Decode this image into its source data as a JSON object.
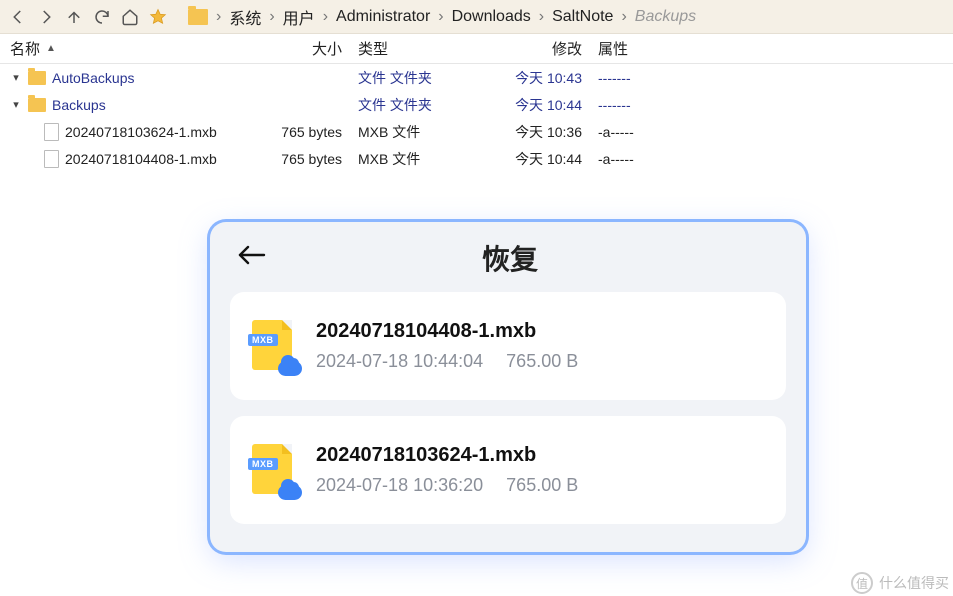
{
  "breadcrumb": [
    "系统",
    "用户",
    "Administrator",
    "Downloads",
    "SaltNote",
    "Backups"
  ],
  "columns": {
    "name": "名称",
    "size": "大小",
    "type": "类型",
    "modified": "修改",
    "attr": "属性"
  },
  "rows": [
    {
      "kind": "folder",
      "name": "AutoBackups",
      "size": "",
      "type": "文件 文件夹",
      "modified": "今天 10:43",
      "attr": "-------",
      "expanded": true,
      "indent": 0
    },
    {
      "kind": "folder",
      "name": "Backups",
      "size": "",
      "type": "文件 文件夹",
      "modified": "今天 10:44",
      "attr": "-------",
      "expanded": true,
      "indent": 0
    },
    {
      "kind": "file",
      "name": "20240718103624-1.mxb",
      "size": "765 bytes",
      "type": "MXB 文件",
      "modified": "今天 10:36",
      "attr": "-a-----",
      "indent": 1
    },
    {
      "kind": "file",
      "name": "20240718104408-1.mxb",
      "size": "765 bytes",
      "type": "MXB 文件",
      "modified": "今天 10:44",
      "attr": "-a-----",
      "indent": 1
    }
  ],
  "modal": {
    "title": "恢复",
    "items": [
      {
        "name": "20240718104408-1.mxb",
        "date": "2024-07-18 10:44:04",
        "size": "765.00 B"
      },
      {
        "name": "20240718103624-1.mxb",
        "date": "2024-07-18 10:36:20",
        "size": "765.00 B"
      }
    ]
  },
  "icon_ext_label": "MXB",
  "watermark": "什么值得买"
}
